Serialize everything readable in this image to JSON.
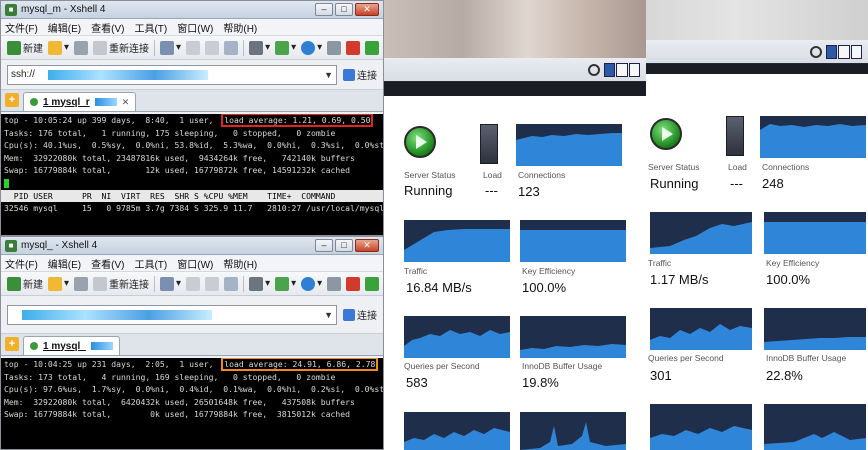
{
  "xshell1": {
    "title": "mysql_m        - Xshell 4",
    "menu": [
      "文件(F)",
      "编辑(E)",
      "查看(V)",
      "工具(T)",
      "窗口(W)",
      "帮助(H)"
    ],
    "toolbar": {
      "new_label": "新建",
      "reconnect_label": "重新连接"
    },
    "address": {
      "value": "ssh://",
      "connect_label": "连接"
    },
    "tab": {
      "label": "1 mysql_r"
    },
    "terminal": {
      "lines": [
        "top - 10:05:24 up 399 days,  8:40,  1 user,  ",
        "Tasks: 176 total,   1 running, 175 sleeping,   0 stopped,   0 zombie",
        "Cpu(s): 40.1%us,  0.5%sy,  0.0%ni, 53.8%id,  5.3%wa,  0.0%hi,  0.3%si,  0.0%st",
        "Mem:  32922080k total, 23487816k used,  9434264k free,   742140k buffers",
        "Swap: 16779884k total,       12k used, 16779872k free, 14591232k cached"
      ],
      "load": "load average: 1.21, 0.69, 0.50",
      "header": "  PID USER      PR  NI  VIRT  RES  SHR S %CPU %MEM    TIME+  COMMAND",
      "process": "32546 mysql     15   0 9785m 3.7g 7384 S 325.9 11.7   2810:27 /usr/local/mysql/b"
    }
  },
  "xshell2": {
    "title": "mysql_        - Xshell 4",
    "menu": [
      "文件(F)",
      "编辑(E)",
      "查看(V)",
      "工具(T)",
      "窗口(W)",
      "帮助(H)"
    ],
    "toolbar": {
      "new_label": "新建",
      "reconnect_label": "重新连接"
    },
    "address": {
      "value": "",
      "connect_label": "连接"
    },
    "tab": {
      "label": "1 mysql_"
    },
    "terminal": {
      "lines": [
        "top - 10:04:25 up 231 days,  2:05,  1 user,  ",
        "Tasks: 173 total,   4 running, 169 sleeping,   0 stopped,   0 zombie",
        "Cpu(s): 97.6%us,  1.7%sy,  0.0%ni,  0.4%id,  0.1%wa,  0.0%hi,  0.2%si,  0.0%st",
        "Mem:  32922080k total,  6420432k used, 26501648k free,   437508k buffers",
        "Swap: 16779884k total,        0k used, 16779884k free,  3815012k cached"
      ],
      "load": "load average: 24.91, 6.86, 2.78"
    }
  },
  "monitor1": {
    "server_status_label": "Server Status",
    "server_status_value": "Running",
    "load_label": "Load",
    "load_value": "---",
    "connections_label": "Connections",
    "connections_value": "123",
    "traffic_label": "Traffic",
    "traffic_value": "16.84 MB/s",
    "key_efficiency_label": "Key Efficiency",
    "key_efficiency_value": "100.0%",
    "qps_label": "Queries per Second",
    "qps_value": "583",
    "innodb_label": "InnoDB Buffer Usage",
    "innodb_value": "19.8%"
  },
  "monitor2": {
    "server_status_label": "Server Status",
    "server_status_value": "Running",
    "load_label": "Load",
    "load_value": "---",
    "connections_label": "Connections",
    "connections_value": "248",
    "traffic_label": "Traffic",
    "traffic_value": "1.17 MB/s",
    "key_efficiency_label": "Key Efficiency",
    "key_efficiency_value": "100.0%",
    "qps_label": "Queries per Second",
    "qps_value": "301",
    "innodb_label": "InnoDB Buffer Usage",
    "innodb_value": "22.8%"
  },
  "colors": {
    "graph_bg": "#1f2e4a",
    "graph_fill": "#2f86d9",
    "highlight_red": "#e02424",
    "highlight_orange": "#f08a1e",
    "terminal_bg": "#000000"
  }
}
